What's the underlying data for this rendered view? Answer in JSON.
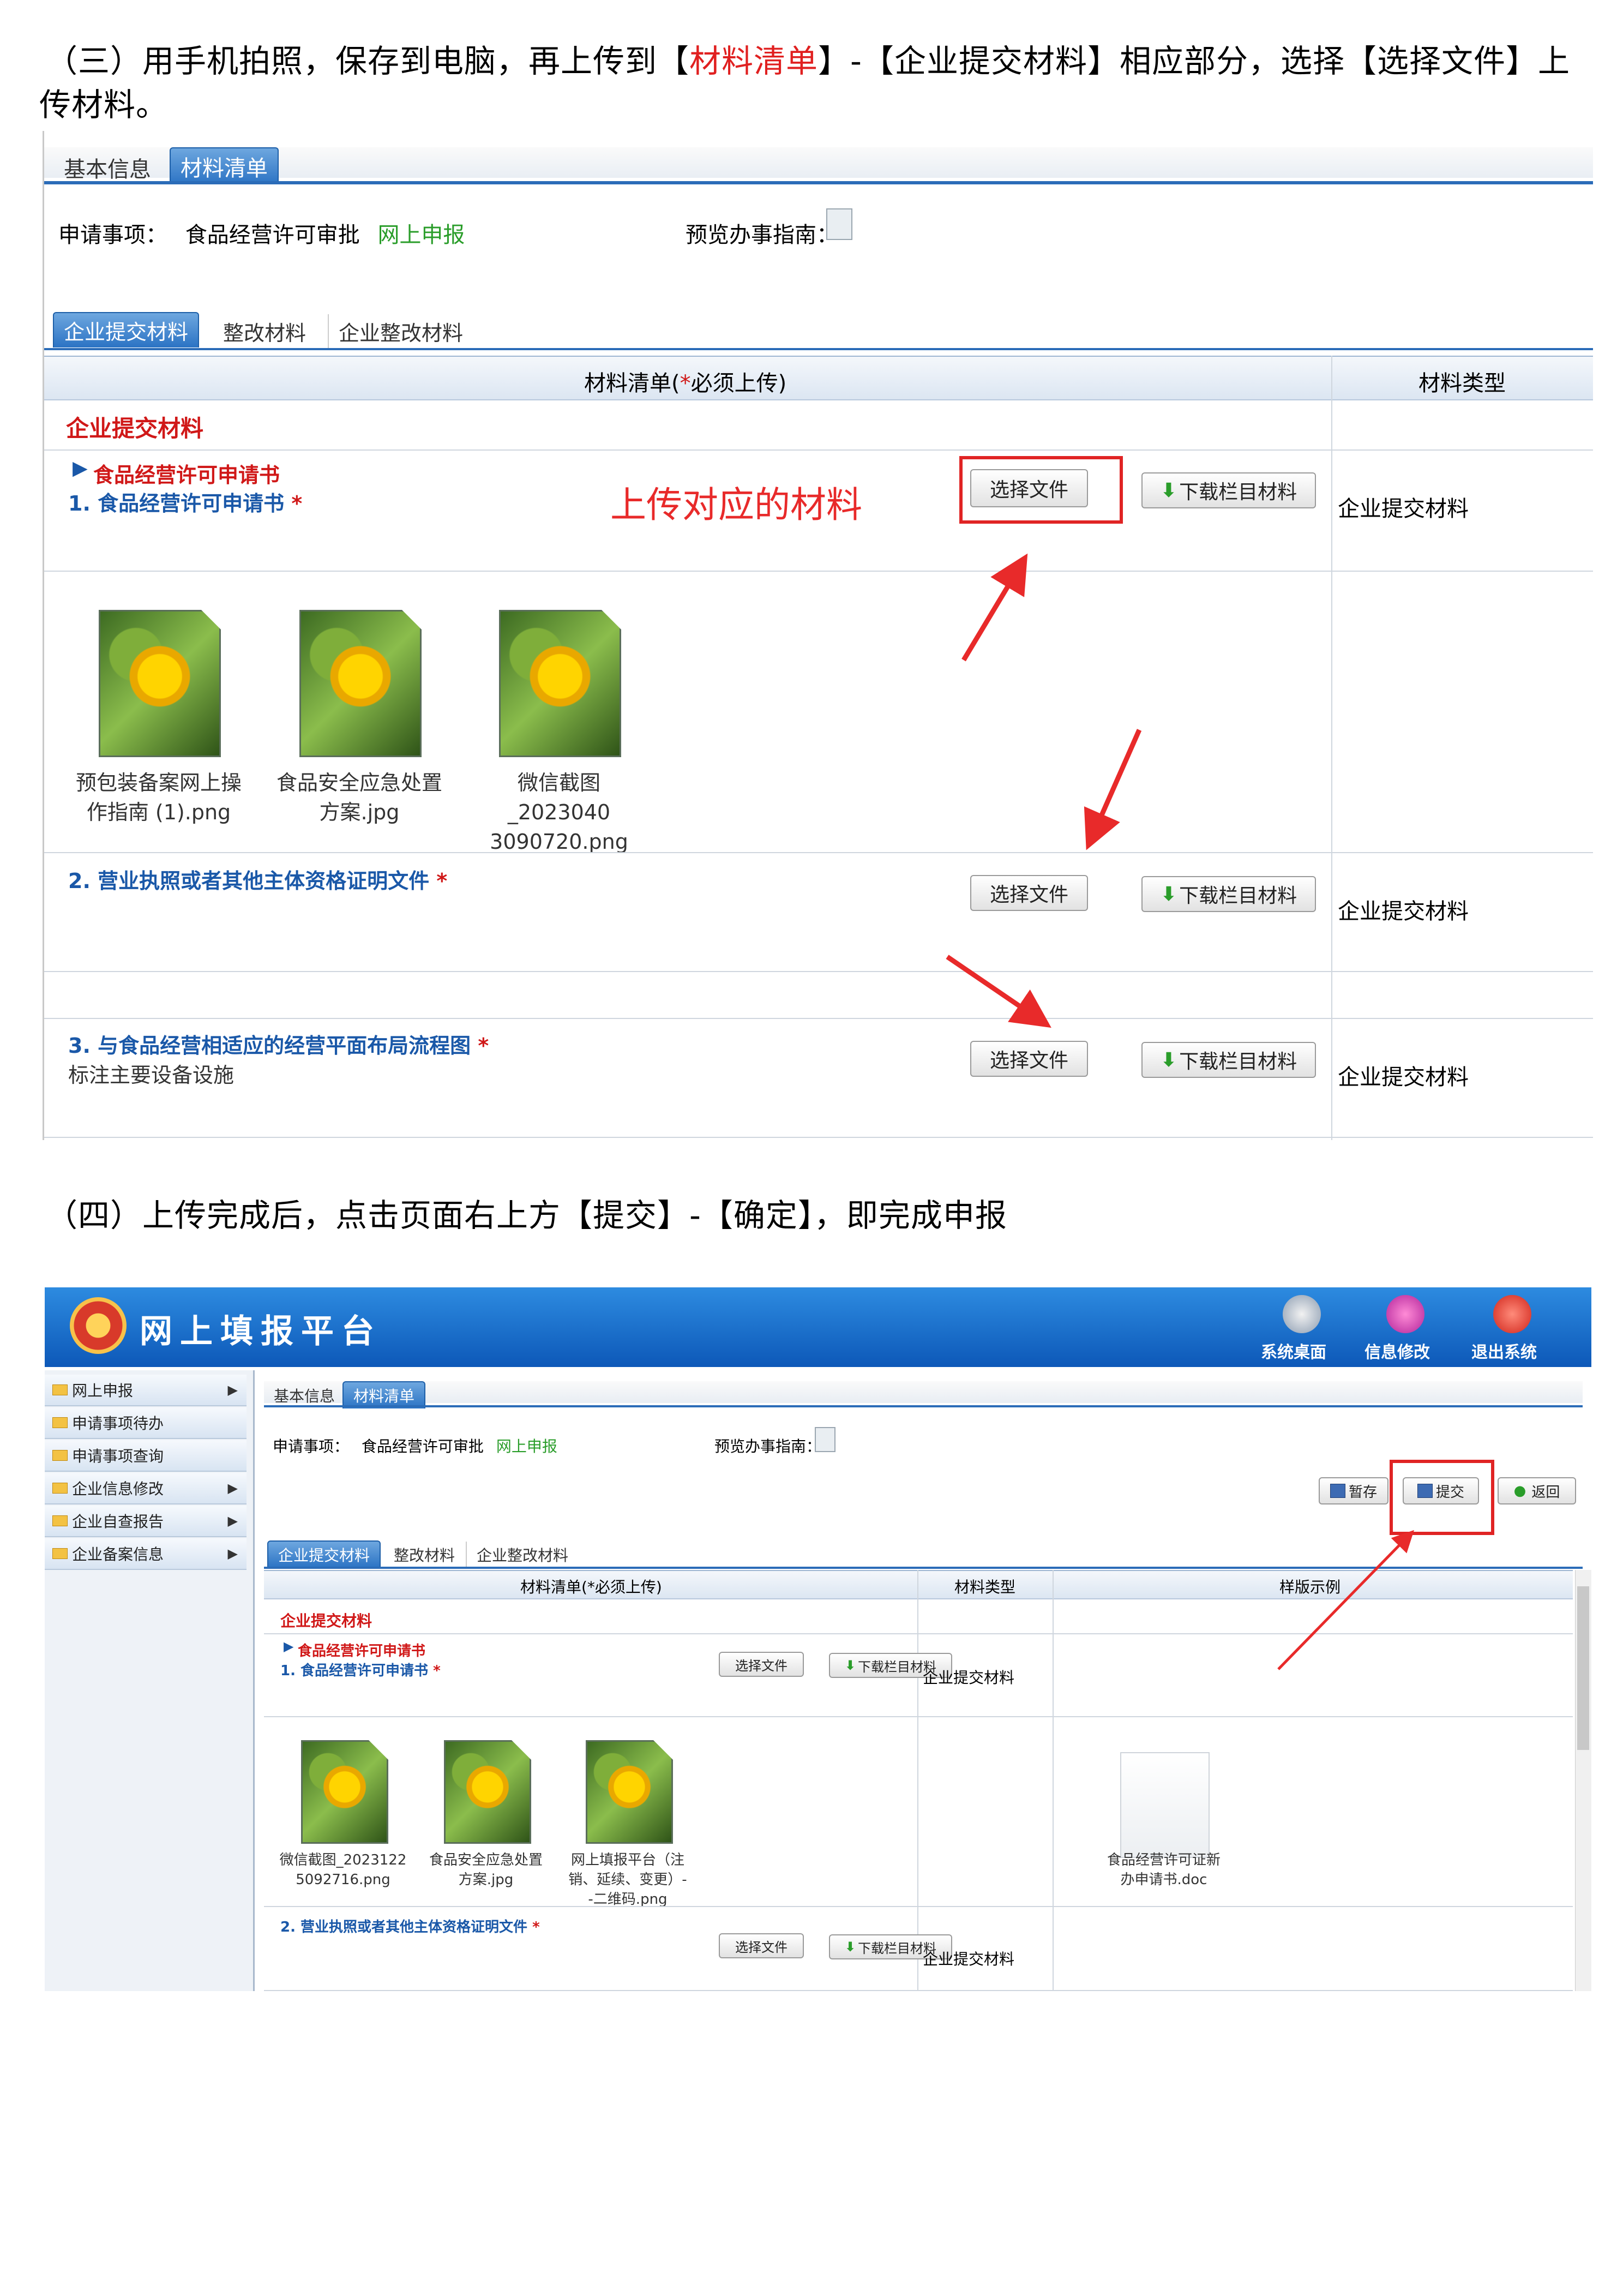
{
  "instructions": {
    "step3_line1_a": "（三）用手机拍照，保存到电脑，再上传到【",
    "step3_line1_b": "材料清单",
    "step3_line1_c": "】-【企业提交材料】相应部分，选择【选择文件】上",
    "step3_line2": "传材料。",
    "step4": "（四）上传完成后，点击页面右上方【提交】-【确定】，即完成申报"
  },
  "shot1": {
    "tabs": [
      "基本信息",
      "材料清单"
    ],
    "apply_label": "申请事项：",
    "apply_value": "食品经营许可审批",
    "apply_link": "网上申报",
    "guide_label": "预览办事指南：",
    "subtabs": [
      "企业提交材料",
      "整改材料",
      "企业整改材料"
    ],
    "col_list": "材料清单(",
    "col_list_star": "*",
    "col_list_end": "必须上传)",
    "col_type": "材料类型",
    "section_title": "企业提交材料",
    "item1_group": "食品经营许可申请书",
    "item1_title": "1. 食品经营许可申请书",
    "annotation": "上传对应的材料",
    "choose": "选择文件",
    "download": "下载栏目材料",
    "type_value": "企业提交材料",
    "files": [
      {
        "line1": "预包装备案网上操",
        "line2": "作指南 (1).png"
      },
      {
        "line1": "食品安全应急处置",
        "line2": "方案.jpg"
      },
      {
        "line1": "微信截图_2023040",
        "line2": "3090720.png"
      }
    ],
    "item2_title": "2. 营业执照或者其他主体资格证明文件",
    "item3_title": "3. 与食品经营相适应的经营平面布局流程图",
    "item3_note": "标注主要设备设施",
    "star": "*"
  },
  "shot2": {
    "platform_title": "网上填报平台",
    "top_buttons": [
      "系统桌面",
      "信息修改",
      "退出系统"
    ],
    "sidebar": [
      "网上申报",
      "申请事项待办",
      "申请事项查询",
      "企业信息修改",
      "企业自查报告",
      "企业备案信息"
    ],
    "tabs": [
      "基本信息",
      "材料清单"
    ],
    "apply_label": "申请事项：",
    "apply_value": "食品经营许可审批",
    "apply_link": "网上申报",
    "guide_label": "预览办事指南：",
    "actions": [
      "暂存",
      "提交",
      "返回"
    ],
    "subtabs": [
      "企业提交材料",
      "整改材料",
      "企业整改材料"
    ],
    "col_list": "材料清单(*必须上传)",
    "col_type": "材料类型",
    "col_sample": "样版示例",
    "section_title": "企业提交材料",
    "item1_group": "食品经营许可申请书",
    "item1_title": "1. 食品经营许可申请书",
    "choose": "选择文件",
    "download": "下载栏目材料",
    "type_value": "企业提交材料",
    "files": [
      {
        "line1": "微信截图_2023122",
        "line2": "5092716.png",
        "line3": ""
      },
      {
        "line1": "食品安全应急处置",
        "line2": "方案.jpg",
        "line3": ""
      },
      {
        "line1": "网上填报平台（注",
        "line2": "销、延续、变更）-",
        "line3": "-二维码.png"
      }
    ],
    "sample_file_line1": "食品经营许可证新",
    "sample_file_line2": "办申请书.doc",
    "item2_title": "2. 营业执照或者其他主体资格证明文件",
    "star": "*"
  }
}
